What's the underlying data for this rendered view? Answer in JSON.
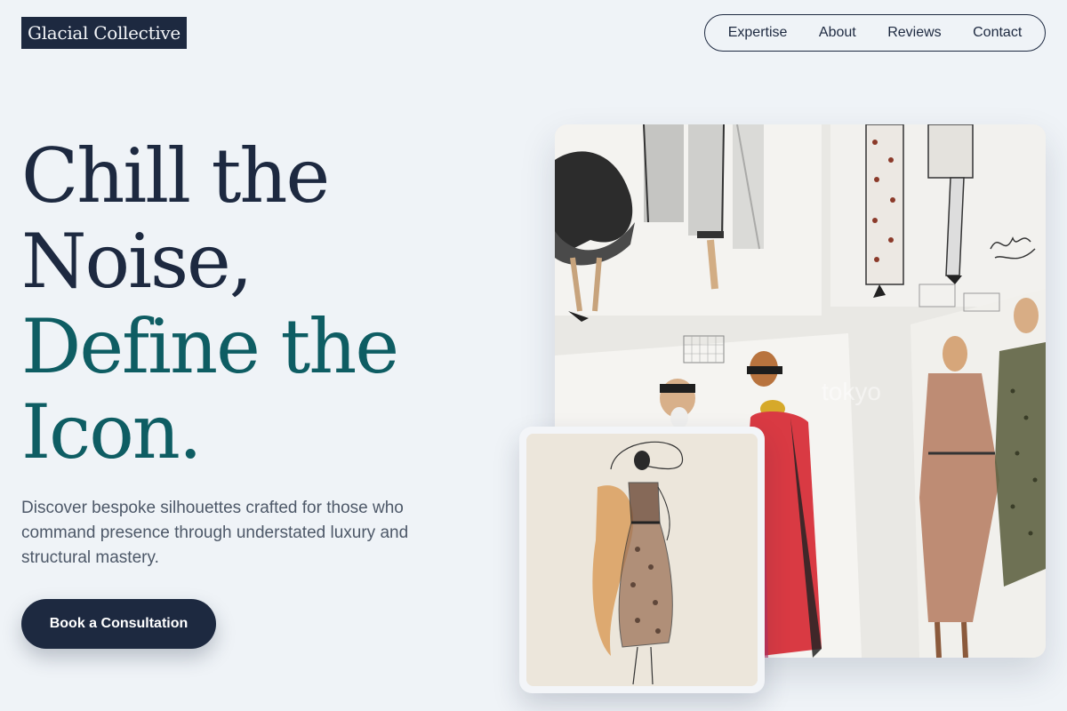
{
  "brand": {
    "name": "Glacial Collective"
  },
  "nav": {
    "items": [
      "Expertise",
      "About",
      "Reviews",
      "Contact"
    ]
  },
  "hero": {
    "headline_line1": "Chill the",
    "headline_line2": "Noise,",
    "headline_line3": "Define the",
    "headline_line4": "Icon.",
    "description": "Discover bespoke silhouettes crafted for those who command presence through understated luxury and structural mastery.",
    "cta_label": "Book a Consultation"
  },
  "colors": {
    "background": "#eff3f7",
    "navy": "#1d2940",
    "teal": "#0e5d63",
    "body_text": "#4d5868"
  },
  "images": {
    "main": "fashion-sketches-wall-photo",
    "inset": "dress-sketch-illustration",
    "main_watermark": "tokyo"
  }
}
